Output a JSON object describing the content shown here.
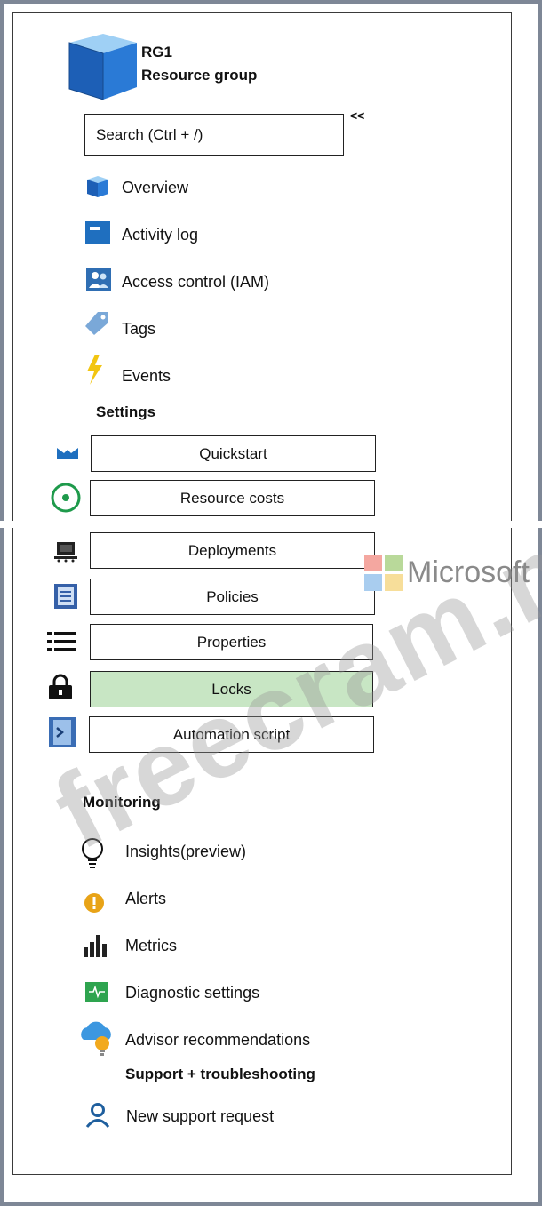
{
  "header": {
    "title": "RG1",
    "subtitle": "Resource group",
    "collapse_label": "<<",
    "icon": "resource-group-cube-icon"
  },
  "search": {
    "placeholder": "Search (Ctrl + /)"
  },
  "nav": {
    "overview": "Overview",
    "activity_log": "Activity log",
    "access_control": "Access control (IAM)",
    "tags": "Tags",
    "events": "Events"
  },
  "settings": {
    "title": "Settings",
    "quickstart": "Quickstart",
    "resource_costs": "Resource costs",
    "deployments": "Deployments",
    "policies": "Policies",
    "properties": "Properties",
    "locks": "Locks",
    "automation_script": "Automation script",
    "selected": "Locks"
  },
  "monitoring": {
    "title": "Monitoring",
    "insights": "Insights(preview)",
    "alerts": "Alerts",
    "metrics": "Metrics",
    "diagnostic_settings": "Diagnostic settings",
    "advisor": "Advisor recommendations"
  },
  "support": {
    "title": "Support + troubleshooting",
    "new_request": "New support request"
  },
  "watermark": {
    "text": "freecram.net",
    "brand": "Microsoft"
  },
  "colors": {
    "selected_bg": "#c8e6c4",
    "azure_blue": "#1f6fbf",
    "event_yellow": "#f2c511",
    "alert_orange": "#e8a317",
    "diag_green": "#2ea44f",
    "cost_green": "#1e9a4b"
  }
}
